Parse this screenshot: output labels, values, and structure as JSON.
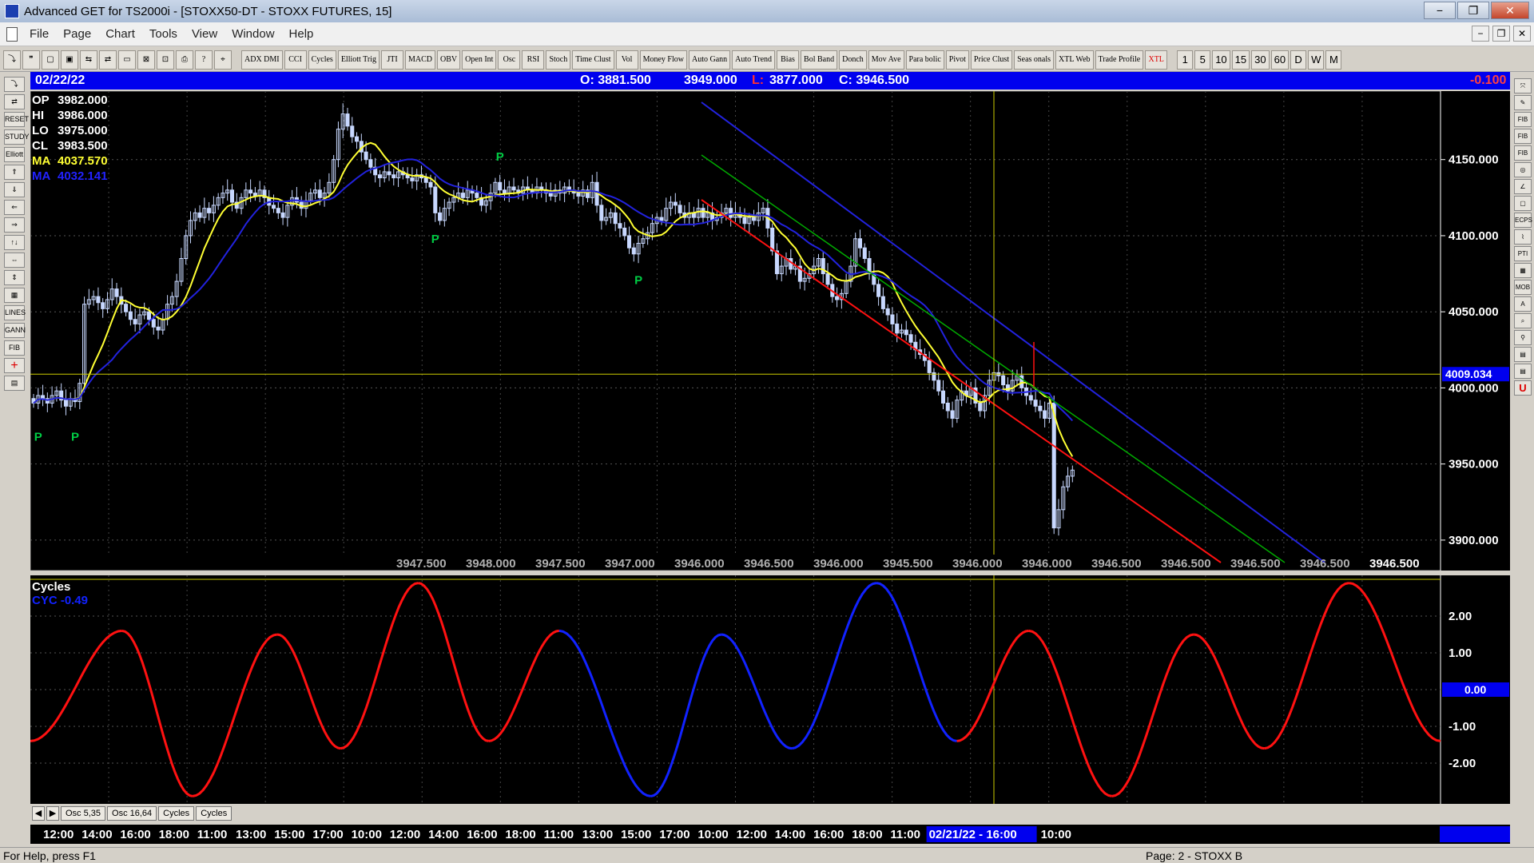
{
  "window": {
    "title": "Advanced GET for TS2000i - [STOXX50-DT - STOXX FUTURES, 15]",
    "minimize": "−",
    "maximize": "❐",
    "close": "✕"
  },
  "menu": [
    "File",
    "Page",
    "Chart",
    "Tools",
    "View",
    "Window",
    "Help"
  ],
  "mdi_controls": [
    "−",
    "❐",
    "✕"
  ],
  "toolbar": {
    "indicators": [
      "ADX DMI",
      "CCI",
      "Cycles",
      "Elliott Trig",
      "JTI",
      "MACD",
      "OBV",
      "Open Int",
      "Osc",
      "RSI",
      "Stoch",
      "Time Clust",
      "Vol",
      "Money Flow",
      "Auto Gann",
      "Auto Trend",
      "Bias",
      "Bol Band",
      "Donch",
      "Mov Ave",
      "Para bolic",
      "Pivot",
      "Price Clust",
      "Seas onals",
      "XTL Web",
      "Trade Profile",
      "XTL"
    ],
    "intervals": [
      "1",
      "5",
      "10",
      "15",
      "30",
      "60",
      "D",
      "W",
      "M"
    ]
  },
  "left_tools": [
    "⤵",
    "⇄",
    "RESET",
    "STUDY",
    "Elliott",
    "⇑",
    "⇓",
    "⇐",
    "⇒",
    "↑↓",
    "⇔",
    "⇕",
    "▦",
    "LINES",
    "GANN",
    "FIB",
    "+",
    "▤"
  ],
  "right_tools": [
    "⤧",
    "✎",
    "FIB RET",
    "FIB EXT",
    "FIB TIME",
    "◎",
    "∠",
    "▢",
    "ECPS",
    "⌇",
    "PTI",
    "▦",
    "MOB",
    "A",
    "⌕",
    "⚲",
    "▤",
    "▤",
    "U"
  ],
  "info_bar": {
    "date": "02/22/22",
    "open": "O: 3881.500",
    "high": "3949.000",
    "low_label": "L:",
    "low": "3877.000",
    "close": "C: 3946.500",
    "change": "-0.100"
  },
  "ohlc_panel": [
    {
      "label": "OP",
      "value": "3982.000",
      "color": "#ffffff"
    },
    {
      "label": "HI",
      "value": "3986.000",
      "color": "#ffffff"
    },
    {
      "label": "LO",
      "value": "3975.000",
      "color": "#ffffff"
    },
    {
      "label": "CL",
      "value": "3983.500",
      "color": "#ffffff"
    },
    {
      "label": "MA",
      "value": "4037.570",
      "color": "#ffff33"
    },
    {
      "label": "MA",
      "value": "4032.141",
      "color": "#2222ff"
    }
  ],
  "colors": {
    "background": "#000000",
    "candle": "#c8d8ff",
    "ma_fast": "#ffff33",
    "ma_slow": "#2222dd",
    "channel_upper": "#2222dd",
    "channel_mid": "#00aa00",
    "channel_lower": "#ff1111",
    "pivot": "#00cc44",
    "cursor": "#cccc00",
    "cycle_red": "#ff1111",
    "cycle_blue": "#1122ff"
  },
  "chart_data": [
    {
      "type": "candlestick",
      "title": "STOXX50-DT - STOXX FUTURES, 15",
      "ylim": [
        3880,
        4195
      ],
      "y_ticks": [
        "4150.000",
        "4100.000",
        "4050.000",
        "4000.000",
        "3950.000",
        "3900.000"
      ],
      "y_tick_values": [
        4150,
        4100,
        4050,
        4000,
        3950,
        3900
      ],
      "horizontal_line": {
        "value": 4009.034,
        "label": "4009.034"
      },
      "price_labels": [
        "3947.500",
        "3948.000",
        "3947.500",
        "3947.000",
        "3946.000",
        "3946.500",
        "3946.000",
        "3945.500",
        "3946.000",
        "3946.000",
        "3946.500",
        "3946.500",
        "3946.500",
        "3946.500",
        "3946.500"
      ],
      "pivot_marker": "P",
      "pivots": [
        {
          "bar": 1,
          "price": 3980,
          "pos": "below"
        },
        {
          "bar": 9,
          "price": 3980,
          "pos": "below"
        },
        {
          "bar": 101,
          "price": 4145,
          "pos": "above"
        },
        {
          "bar": 87,
          "price": 4110,
          "pos": "below"
        },
        {
          "bar": 131,
          "price": 4083,
          "pos": "below"
        }
      ],
      "close": [
        3990,
        3995,
        3993,
        3990,
        3995,
        3998,
        3992,
        3988,
        3993,
        3991,
        4003,
        4055,
        4058,
        4060,
        4056,
        4052,
        4058,
        4065,
        4060,
        4055,
        4050,
        4045,
        4042,
        4048,
        4050,
        4045,
        4040,
        4038,
        4045,
        4055,
        4060,
        4070,
        4085,
        4100,
        4110,
        4115,
        4112,
        4118,
        4115,
        4120,
        4125,
        4128,
        4130,
        4122,
        4118,
        4125,
        4130,
        4128,
        4126,
        4130,
        4125,
        4120,
        4118,
        4115,
        4112,
        4120,
        4125,
        4122,
        4118,
        4123,
        4128,
        4130,
        4125,
        4128,
        4135,
        4150,
        4170,
        4180,
        4172,
        4165,
        4162,
        4155,
        4150,
        4145,
        4140,
        4138,
        4142,
        4140,
        4138,
        4142,
        4140,
        4138,
        4136,
        4140,
        4138,
        4135,
        4132,
        4115,
        4110,
        4118,
        4122,
        4125,
        4128,
        4125,
        4130,
        4128,
        4125,
        4120,
        4123,
        4128,
        4135,
        4130,
        4128,
        4132,
        4130,
        4128,
        4132,
        4130,
        4128,
        4132,
        4130,
        4128,
        4126,
        4130,
        4128,
        4132,
        4130,
        4128,
        4126,
        4130,
        4125,
        4135,
        4120,
        4110,
        4112,
        4115,
        4108,
        4105,
        4100,
        4092,
        4088,
        4095,
        4098,
        4102,
        4108,
        4112,
        4110,
        4118,
        4122,
        4120,
        4115,
        4112,
        4115,
        4112,
        4118,
        4112,
        4115,
        4110,
        4112,
        4115,
        4118,
        4112,
        4115,
        4112,
        4108,
        4112,
        4110,
        4115,
        4118,
        4105,
        4090,
        4075,
        4080,
        4085,
        4078,
        4080,
        4070,
        4072,
        4075,
        4080,
        4085,
        4075,
        4068,
        4060,
        4058,
        4062,
        4070,
        4080,
        4098,
        4092,
        4085,
        4075,
        4068,
        4060,
        4052,
        4048,
        4042,
        4036,
        4038,
        4035,
        4030,
        4025,
        4022,
        4018,
        4010,
        4005,
        3998,
        3990,
        3985,
        3980,
        3992,
        3998,
        3995,
        4000,
        3990,
        3985,
        3995,
        4005,
        4010,
        4008,
        4002,
        3998,
        4005,
        4008,
        4000,
        3995,
        3992,
        3988,
        3985,
        3980,
        3990,
        3908,
        3920,
        3935,
        3942,
        3946
      ],
      "series": [
        {
          "name": "MA",
          "value": 4037.57
        },
        {
          "name": "MA",
          "value": 4032.141
        }
      ]
    },
    {
      "type": "line",
      "title": "Cycles",
      "legend": "CYC -0.49",
      "ylim": [
        -3.0,
        3.0
      ],
      "y_ticks": [
        "2.00",
        "1.00",
        "0.00",
        "-1.00",
        "-2.00"
      ],
      "y_tick_values": [
        2,
        1,
        0,
        -1,
        -2
      ],
      "current_value": "0.00",
      "x_ticks": [
        "12:00",
        "14:00",
        "16:00",
        "18:00",
        "11:00",
        "13:00",
        "15:00",
        "17:00",
        "10:00",
        "12:00",
        "14:00",
        "16:00",
        "18:00",
        "11:00",
        "13:00",
        "15:00",
        "17:00",
        "10:00",
        "12:00",
        "14:00",
        "16:00",
        "18:00",
        "11:00",
        "02/21/22 - 16:00",
        "10:00"
      ],
      "cursor_label": "02/21/22 - 16:00",
      "extrema": [
        {
          "t": 0.0,
          "v": -1.4,
          "c": "red"
        },
        {
          "t": 0.065,
          "v": 1.6,
          "c": "red"
        },
        {
          "t": 0.115,
          "v": -2.9,
          "c": "red"
        },
        {
          "t": 0.175,
          "v": 1.5,
          "c": "red"
        },
        {
          "t": 0.22,
          "v": -1.6,
          "c": "red"
        },
        {
          "t": 0.275,
          "v": 2.9,
          "c": "red"
        },
        {
          "t": 0.325,
          "v": -1.4,
          "c": "red"
        },
        {
          "t": 0.375,
          "v": 1.6,
          "c": "red"
        },
        {
          "t": 0.44,
          "v": -2.9,
          "c": "blue"
        },
        {
          "t": 0.49,
          "v": 1.5,
          "c": "blue"
        },
        {
          "t": 0.54,
          "v": -1.6,
          "c": "blue"
        },
        {
          "t": 0.6,
          "v": 2.9,
          "c": "blue"
        },
        {
          "t": 0.657,
          "v": -1.4,
          "c": "blue"
        },
        {
          "t": 0.708,
          "v": 1.6,
          "c": "red"
        },
        {
          "t": 0.767,
          "v": -2.9,
          "c": "red"
        },
        {
          "t": 0.825,
          "v": 1.5,
          "c": "red"
        },
        {
          "t": 0.875,
          "v": -1.6,
          "c": "red"
        },
        {
          "t": 0.935,
          "v": 2.9,
          "c": "red"
        },
        {
          "t": 1.0,
          "v": -1.4,
          "c": "red"
        }
      ]
    }
  ],
  "tabs": [
    "◀",
    "▶",
    "Osc 5,35",
    "Osc 16,64",
    "Cycles",
    "Cycles"
  ],
  "status": {
    "left": "For Help, press F1",
    "right": "Page: 2 - STOXX B"
  }
}
